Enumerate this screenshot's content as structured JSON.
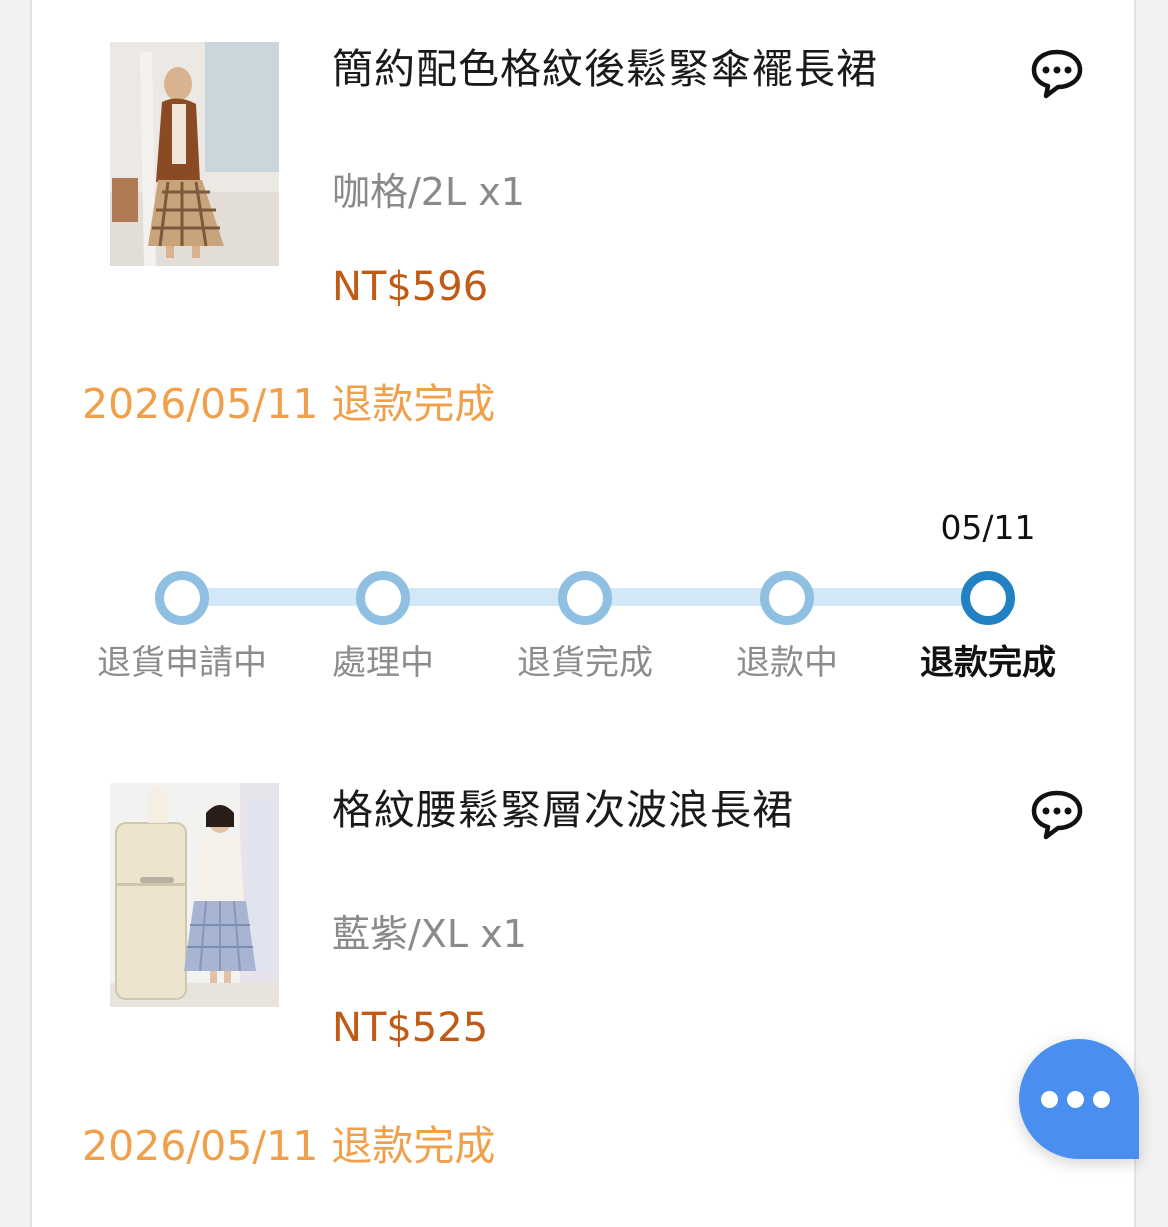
{
  "orders": [
    {
      "name": "簡約配色格紋後鬆緊傘襬長裙",
      "variant": "咖格/2L x1",
      "price": "NT$596",
      "status": "2026/05/11 退款完成",
      "chat_icon": "chat-bubble-icon"
    },
    {
      "name": "格紋腰鬆緊層次波浪長裙",
      "variant": "藍紫/XL x1",
      "price": "NT$525",
      "status": "2026/05/11 退款完成",
      "chat_icon": "chat-bubble-icon"
    }
  ],
  "progress": {
    "steps": [
      {
        "label": "退貨申請中",
        "date": "",
        "active": false
      },
      {
        "label": "處理中",
        "date": "",
        "active": false
      },
      {
        "label": "退貨完成",
        "date": "",
        "active": false
      },
      {
        "label": "退款中",
        "date": "",
        "active": false
      },
      {
        "label": "退款完成",
        "date": "05/11",
        "active": true
      }
    ]
  },
  "fab": {
    "icon": "more-dots-icon"
  },
  "colors": {
    "price": "#c15a14",
    "status": "#f0a04b",
    "step_inactive": "#8fc0e2",
    "step_active": "#2181c2",
    "track": "#d3e8f7",
    "fab": "#4a8ef0"
  }
}
